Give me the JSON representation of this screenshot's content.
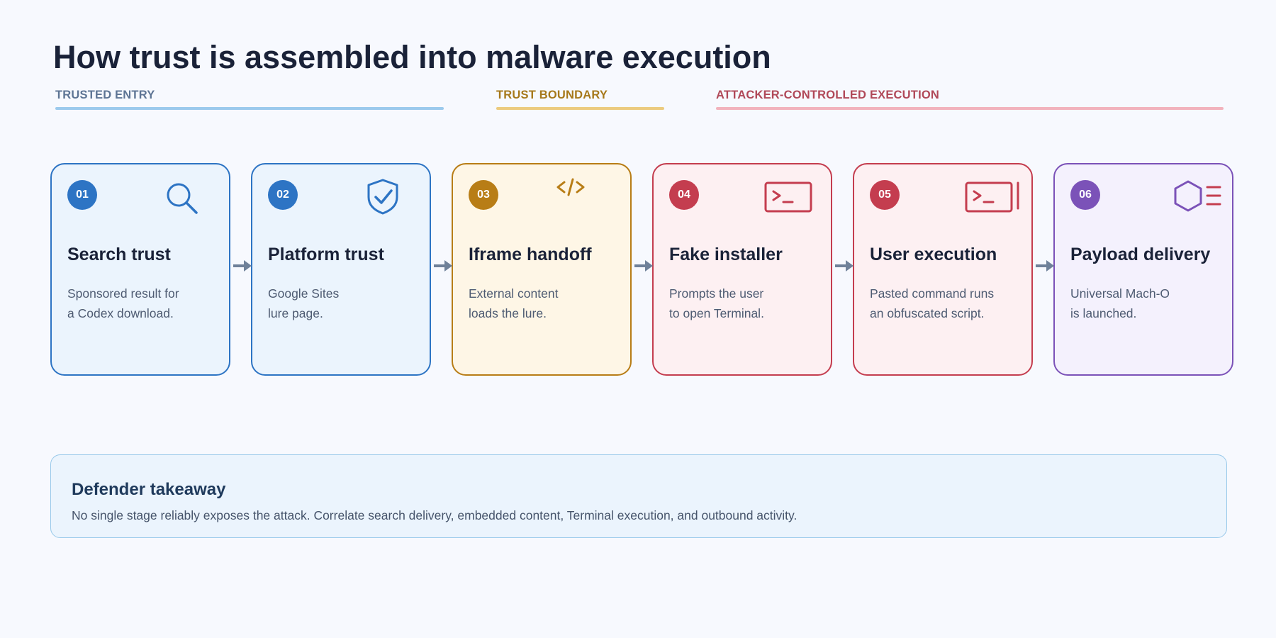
{
  "title": "How trust is assembled into malware execution",
  "zones": [
    {
      "label": "TRUSTED ENTRY",
      "color": "#5d7494",
      "line_color": "#9ccaed"
    },
    {
      "label": "TRUST BOUNDARY",
      "color": "#a6781a",
      "line_color": "#eccb7f"
    },
    {
      "label": "ATTACKER-CONTROLLED EXECUTION",
      "color": "#b04858",
      "line_color": "#f2b3bd"
    }
  ],
  "stages": [
    {
      "number": "01",
      "title": "Search trust",
      "desc": [
        "Sponsored result for",
        "a Codex download."
      ],
      "icon": "search-icon",
      "border": "#2d74c4",
      "fill": "#ebf4fd",
      "badge": "#2d74c4"
    },
    {
      "number": "02",
      "title": "Platform trust",
      "desc": [
        "Google Sites",
        "lure page."
      ],
      "icon": "shield-check-icon",
      "border": "#2d74c4",
      "fill": "#ebf4fd",
      "badge": "#2d74c4"
    },
    {
      "number": "03",
      "title": "Iframe handoff",
      "desc": [
        "External content",
        "loads the lure."
      ],
      "icon": "code-icon",
      "border": "#b87d16",
      "fill": "#fef6e6",
      "badge": "#b87d16"
    },
    {
      "number": "04",
      "title": "Fake installer",
      "desc": [
        "Prompts the user",
        "to open Terminal."
      ],
      "icon": "terminal-icon",
      "border": "#c43d4f",
      "fill": "#fdf0f2",
      "badge": "#c43d4f"
    },
    {
      "number": "05",
      "title": "User execution",
      "desc": [
        "Pasted command runs",
        "an obfuscated script."
      ],
      "icon": "terminal-cursor-icon",
      "border": "#c43d4f",
      "fill": "#fdf0f2",
      "badge": "#c43d4f"
    },
    {
      "number": "06",
      "title": "Payload delivery",
      "desc": [
        "Universal Mach-O",
        "is launched."
      ],
      "icon": "hexagon-binary-icon",
      "border": "#7b52b8",
      "fill": "#f4f1fd",
      "badge": "#7b52b8"
    }
  ],
  "arrow_color": "#6f8199",
  "takeaway": {
    "title": "Defender takeaway",
    "text": "No single stage reliably exposes the attack. Correlate search delivery, embedded content, Terminal execution, and outbound activity."
  }
}
